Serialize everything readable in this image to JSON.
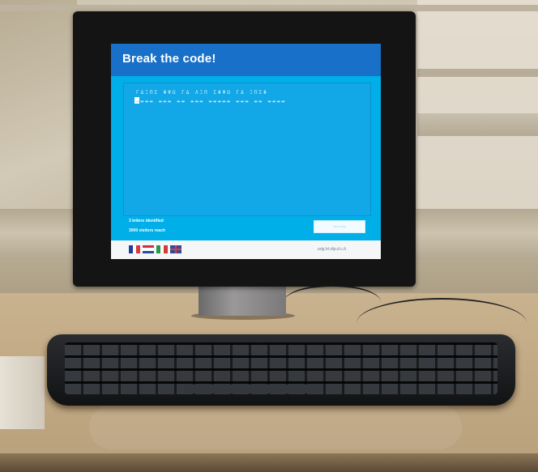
{
  "screen": {
    "title": "Break the code!",
    "cipher_text": "ΓΔΞΠΣ ΦΨΩ ΓΔ ΛΞΠ ΣΦΨΩ ΓΔ ΞΠΣΦ",
    "answer_text": "▬▬▬▬ ▬▬▬ ▬▬ ▬▬▬ ▬▬▬▬▬ ▬▬▬ ▬▬ ▬▬▬▬",
    "stats": {
      "letters": "3 letters identified",
      "visitors": "3000 visitors reach"
    },
    "button_label": "next step",
    "footer_logo": "orig.ht.slip.d.c.b"
  },
  "languages": [
    "French",
    "Dutch",
    "Italian",
    "English"
  ],
  "colors": {
    "header": "#1870c9",
    "screen_bg": "#00aee8",
    "code_area": "#12a7e6",
    "footer": "#f4f6f8"
  }
}
